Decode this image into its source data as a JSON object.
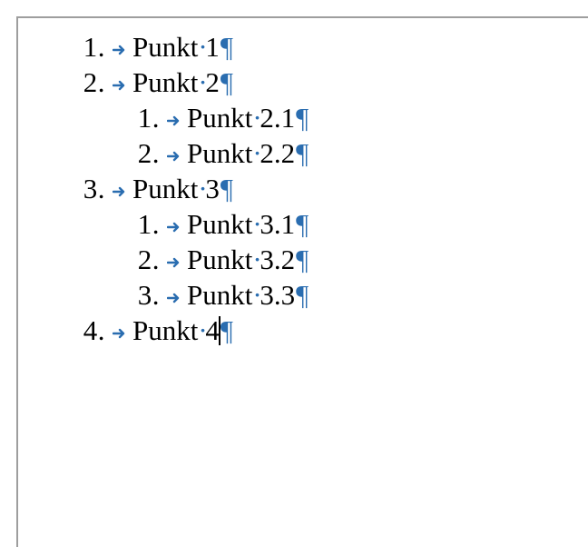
{
  "formatting_marks": {
    "tab_arrow_color": "#2a6db0",
    "space_dot_color": "#2a6db0",
    "pilcrow_color": "#2a6db0"
  },
  "list": {
    "items": [
      {
        "level": 1,
        "number": "1.",
        "word": "Punkt",
        "suffix": "1"
      },
      {
        "level": 1,
        "number": "2.",
        "word": "Punkt",
        "suffix": "2"
      },
      {
        "level": 2,
        "number": "1.",
        "word": "Punkt",
        "suffix": "2.1"
      },
      {
        "level": 2,
        "number": "2.",
        "word": "Punkt",
        "suffix": "2.2"
      },
      {
        "level": 1,
        "number": "3.",
        "word": "Punkt",
        "suffix": "3"
      },
      {
        "level": 2,
        "number": "1.",
        "word": "Punkt",
        "suffix": "3.1"
      },
      {
        "level": 2,
        "number": "2.",
        "word": "Punkt",
        "suffix": "3.2"
      },
      {
        "level": 2,
        "number": "3.",
        "word": "Punkt",
        "suffix": "3.3"
      },
      {
        "level": 1,
        "number": "4.",
        "word": "Punkt",
        "suffix": "4",
        "cursor_after_suffix": true
      }
    ]
  }
}
